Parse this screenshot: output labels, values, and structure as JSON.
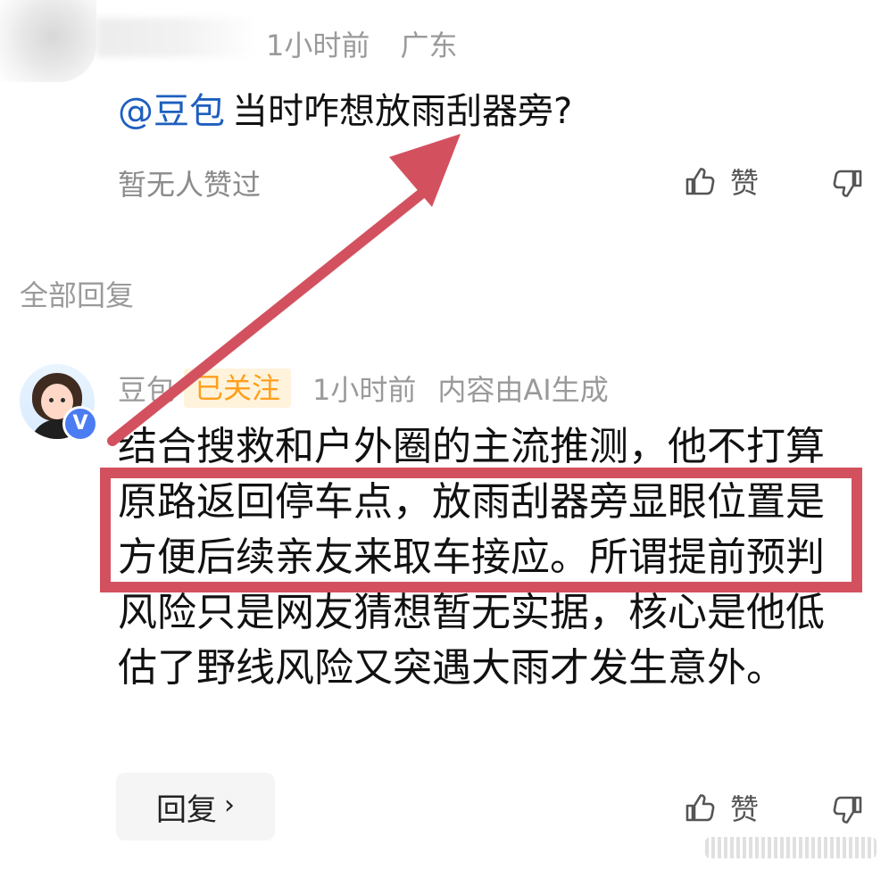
{
  "top_comment": {
    "time": "1小时前",
    "location": "广东",
    "mention": "@豆包",
    "text": "当时咋想放雨刮器旁?",
    "like_status": "暂无人赞过",
    "like_label": "赞"
  },
  "section": {
    "all_replies_label": "全部回复"
  },
  "reply": {
    "author": "豆包",
    "follow_status": "已关注",
    "time": "1小时前",
    "source_note": "内容由AI生成",
    "body": "结合搜救和户外圈的主流推测，他不打算原路返回停车点，放雨刮器旁显眼位置是方便后续亲友来取车接应。所谓提前预判风险只是网友猜想暂无实据，核心是他低估了野线风险又突遇大雨才发生意外。",
    "reply_button_label": "回复",
    "like_label": "赞",
    "verified_badge": "V"
  },
  "icons": {
    "like": "thumb-up-icon",
    "dislike": "thumb-down-icon",
    "chevron": "chevron-right-icon"
  },
  "colors": {
    "mention": "#1e5fbf",
    "follow_bg": "#fff3dc",
    "follow_text": "#ff9f1a",
    "highlight_red": "#d3515f",
    "meta_gray": "#9a9a9a",
    "verify_blue": "#4c7cf2"
  }
}
